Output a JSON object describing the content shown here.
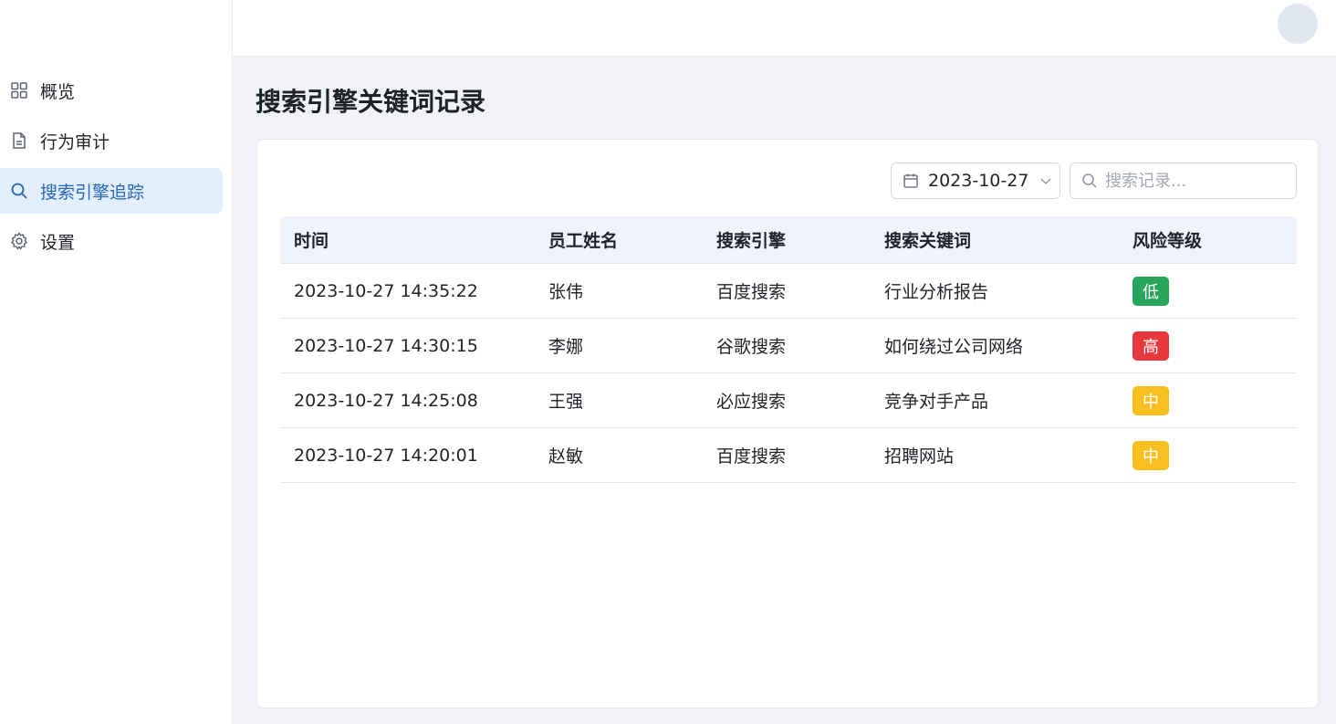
{
  "sidebar": {
    "items": [
      {
        "label": "概览",
        "icon": "grid-icon",
        "active": false
      },
      {
        "label": "行为审计",
        "icon": "document-icon",
        "active": false
      },
      {
        "label": "搜索引擎追踪",
        "icon": "search-icon",
        "active": true
      },
      {
        "label": "设置",
        "icon": "gear-icon",
        "active": false
      }
    ]
  },
  "header": {
    "avatar": "avatar"
  },
  "main": {
    "title": "搜索引擎关键词记录",
    "filters": {
      "date": "2023-10-27",
      "search_placeholder": "搜索记录..."
    },
    "table": {
      "columns": [
        "时间",
        "员工姓名",
        "搜索引擎",
        "搜索关键词",
        "风险等级"
      ],
      "rows": [
        {
          "time": "2023-10-27 14:35:22",
          "name": "张伟",
          "engine": "百度搜索",
          "keyword": "行业分析报告",
          "risk": "低",
          "risk_color": "#27a55a"
        },
        {
          "time": "2023-10-27 14:30:15",
          "name": "李娜",
          "engine": "谷歌搜索",
          "keyword": "如何绕过公司网络",
          "risk": "高",
          "risk_color": "#e5393e"
        },
        {
          "time": "2023-10-27 14:25:08",
          "name": "王强",
          "engine": "必应搜索",
          "keyword": "竞争对手产品",
          "risk": "中",
          "risk_color": "#f7bf1f"
        },
        {
          "time": "2023-10-27 14:20:01",
          "name": "赵敏",
          "engine": "百度搜索",
          "keyword": "招聘网站",
          "risk": "中",
          "risk_color": "#f7bf1f"
        }
      ]
    }
  },
  "colors": {
    "accent": "#2a66b8",
    "active_bg": "#e3effc",
    "page_bg": "#f0f2f5"
  }
}
